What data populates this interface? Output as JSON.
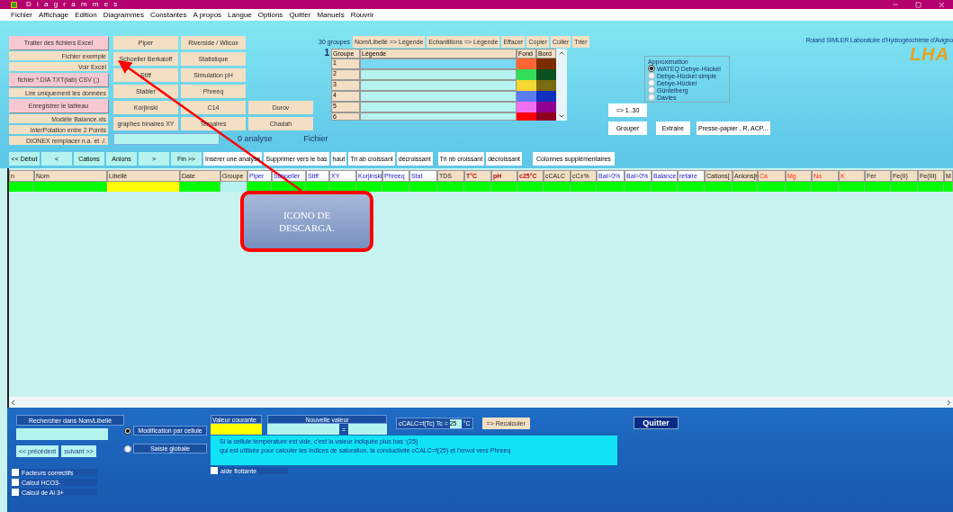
{
  "window": {
    "title": "D i a g r a m m e s"
  },
  "menu": [
    "Fichier",
    "Affichage",
    "Edition",
    "Diagrammes",
    "Constantes",
    "A propos",
    "Langue",
    "Options",
    "Quitter",
    "Manuels",
    "Rouvrir"
  ],
  "left_buttons": [
    {
      "label": "Traiter des fichiers Excel",
      "kind": "main"
    },
    {
      "label": "Fichier exemple",
      "kind": "sub"
    },
    {
      "label": "Voir Excel",
      "kind": "sub"
    },
    {
      "label": "fichier *.DIA TXT(tab) CSV (;)",
      "kind": "main"
    },
    {
      "label": "Lire uniquement les données",
      "kind": "sub"
    },
    {
      "label": "Enregistrer le tableau",
      "kind": "main"
    },
    {
      "label": "Modèle Balance.xls",
      "kind": "sub"
    },
    {
      "label": "InterPolation entre 2 Points",
      "kind": "sub"
    },
    {
      "label": "DIONEX remplacer n.a. et ./.",
      "kind": "sub"
    }
  ],
  "diagram_buttons": [
    [
      "Piper",
      "Riverside / Wilcox"
    ],
    [
      "Schoeller Berkaloff",
      "Statistique"
    ],
    [
      "Stiff",
      "Simulation pH"
    ],
    [
      "Stabler",
      "Phreeq"
    ],
    [
      "Korjinski",
      "C14",
      "Durov"
    ],
    [
      "graphes binaires XY",
      "Ternaires",
      "Chadah"
    ]
  ],
  "analysis_count": "0 analyse",
  "file_label": "Fichier",
  "groups": {
    "count_label": "30 groupes",
    "buttons": [
      "Nom/Libellé => Légende",
      "Echantillons => Légende",
      "Effacer",
      "Copier",
      "Coller",
      "Trier"
    ],
    "current": "1",
    "columns": [
      "Groupe",
      "Légende",
      "Fond",
      "Bord"
    ],
    "rows": [
      {
        "group": "1",
        "selected": true,
        "swatches": [
          {
            "color": "#ff6633"
          },
          {
            "color": "#7a2e00"
          }
        ]
      },
      {
        "group": "2",
        "selected": false,
        "swatches": [
          {
            "color": "#33dd55"
          },
          {
            "color": "#0a5020"
          }
        ]
      },
      {
        "group": "3",
        "selected": false,
        "swatches": [
          {
            "color": "#f5d830"
          },
          {
            "color": "#7a6a10"
          }
        ]
      },
      {
        "group": "4",
        "selected": false,
        "swatches": [
          {
            "color": "#5a7df0"
          },
          {
            "color": "#1030c0"
          }
        ]
      },
      {
        "group": "5",
        "selected": false,
        "swatches": [
          {
            "color": "#f070f0"
          },
          {
            "color": "#900090"
          }
        ]
      },
      {
        "group": "6",
        "selected": false,
        "swatches": [
          {
            "color": "#ff0000"
          },
          {
            "color": "#900020"
          }
        ]
      }
    ]
  },
  "range_button": "=> 1..30",
  "group_button": "Grouper",
  "extract_button": "Extraire",
  "clipboard_button": "Presse-papier , R, ACP...",
  "approximation": {
    "title": "Approximation",
    "options": [
      {
        "label": "WATEQ Debye-Hückel",
        "selected": true
      },
      {
        "label": "Debye-Hückel simple",
        "selected": false
      },
      {
        "label": "Debye-Hückel",
        "selected": false
      },
      {
        "label": "Güntelberg",
        "selected": false
      },
      {
        "label": "Davies",
        "selected": false
      }
    ]
  },
  "author": "Roland SIMLER Laboratoire d'Hydrogéochimie d'Avigno",
  "logo": "LHA",
  "nav_buttons": [
    "<< Début",
    "<",
    "Cations",
    "Anions",
    ">",
    "Fin >>"
  ],
  "action_buttons": [
    "Insérer une analyse",
    "Supprimer vers le bas",
    "haut",
    "Tri ab croissant",
    "décroissant",
    "Tri nb croissant",
    "décroissant"
  ],
  "extra_columns_button": "Colonnes supplémentaires",
  "table": {
    "columns": [
      {
        "label": "n",
        "kind": "plain"
      },
      {
        "label": "Nom",
        "kind": "plain"
      },
      {
        "label": "Libellé",
        "kind": "plain"
      },
      {
        "label": "Date",
        "kind": "plain"
      },
      {
        "label": "Groupe",
        "kind": "plain"
      },
      {
        "label": "Piper",
        "kind": "diagram"
      },
      {
        "label": "Schoeller",
        "kind": "diagram"
      },
      {
        "label": "Stiff",
        "kind": "diagram"
      },
      {
        "label": "XY",
        "kind": "diagram"
      },
      {
        "label": "Korjinski",
        "kind": "diagram"
      },
      {
        "label": "Phreeq",
        "kind": "diagram"
      },
      {
        "label": "Stat",
        "kind": "diagram"
      },
      {
        "label": "TDS",
        "kind": "plain"
      },
      {
        "label": "T°C",
        "kind": "key"
      },
      {
        "label": "pH",
        "kind": "key"
      },
      {
        "label": "c25°C",
        "kind": "key"
      },
      {
        "label": "cCALC",
        "kind": "plain"
      },
      {
        "label": "cC±%",
        "kind": "plain"
      },
      {
        "label": "Bal=0%",
        "kind": "diagram"
      },
      {
        "label": "Bal=0%",
        "kind": "diagram"
      },
      {
        "label": "Balance",
        "kind": "diagram"
      },
      {
        "label": "refaire",
        "kind": "diagram"
      },
      {
        "label": "Cations[",
        "kind": "plain"
      },
      {
        "label": "Anions[r",
        "kind": "plain"
      },
      {
        "label": "Ca",
        "kind": "ion"
      },
      {
        "label": "Mg",
        "kind": "ion"
      },
      {
        "label": "Na",
        "kind": "ion"
      },
      {
        "label": "K",
        "kind": "ion"
      },
      {
        "label": "Fer",
        "kind": "plain"
      },
      {
        "label": "Fe(II)",
        "kind": "plain"
      },
      {
        "label": "Fe(III)",
        "kind": "plain"
      },
      {
        "label": "M",
        "kind": "plain"
      }
    ]
  },
  "bottom": {
    "search_label": "Rechercher dans Nom/Libellé",
    "prev_button": "<< précédent",
    "next_button": "suivant >>",
    "modes": [
      {
        "label": "Modification par cellule",
        "selected": true
      },
      {
        "label": "Saisie globale",
        "selected": false
      }
    ],
    "current_value_label": "Valeur courante",
    "new_value_label": "Nouvelle valeur",
    "equals_button": "=",
    "temp_label": "cCALC=f(Tc)  Tc =",
    "temp_value": "25",
    "temp_unit": "°C",
    "recalc_button": "=> Recalculer",
    "quit_button": "Quitter",
    "help_lines": [
      "Si la cellule température est vide, c'est la valeur indiquée plus bas :(25)",
      "qui est utilisée pour calculer les indices de saturation, la conductivité  cCALC=f(25) et l'envoi vers Phreeq"
    ],
    "floating_help": {
      "label": "aide flottante",
      "checked": false
    },
    "options": [
      {
        "label": "Facteurs correctifs",
        "checked": false
      },
      {
        "label": "Calcul HCO3-",
        "checked": false
      },
      {
        "label": "Calcul de Al 3+",
        "checked": false
      }
    ]
  },
  "annotation": {
    "text": "ICONO DE DESCARGA."
  }
}
